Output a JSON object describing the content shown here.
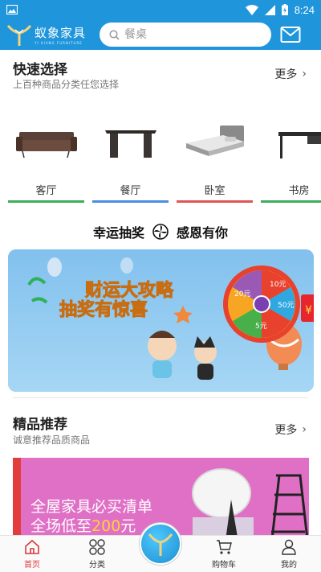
{
  "status_bar": {
    "time": "8:24"
  },
  "header": {
    "logo_name": "蚁象家具",
    "logo_sub": "YI XIANG FURNITURE",
    "search_placeholder": "餐桌"
  },
  "quick_select": {
    "title": "快速选择",
    "subtitle": "上百种商品分类任您选择",
    "more": "更多",
    "categories": [
      {
        "label": "客厅",
        "color": "#3fae5a"
      },
      {
        "label": "餐厅",
        "color": "#4a8de0"
      },
      {
        "label": "卧室",
        "color": "#e25555"
      },
      {
        "label": "书房",
        "color": "#3fae5a"
      }
    ]
  },
  "lottery": {
    "title_left": "幸运抽奖",
    "title_right": "感恩有你",
    "banner_line1": "财运大攻略",
    "banner_line2": "抽奖有惊喜",
    "wheel_labels": [
      "10元",
      "50元",
      "5元",
      "20元"
    ]
  },
  "featured": {
    "title": "精品推荐",
    "subtitle": "诚意推荐品质商品",
    "more": "更多",
    "promo_line1": "全屋家具必买清单",
    "promo_line2_prefix": "全场低至",
    "promo_line2_amount": "200",
    "promo_line2_suffix": "元"
  },
  "bottom_nav": {
    "items": [
      {
        "label": "首页",
        "icon": "home-icon",
        "active": true
      },
      {
        "label": "分类",
        "icon": "grid-icon",
        "active": false
      },
      {
        "label": "购物车",
        "icon": "cart-icon",
        "active": false
      },
      {
        "label": "我的",
        "icon": "user-icon",
        "active": false
      }
    ],
    "accent": "#d9393a"
  },
  "colors": {
    "primary": "#1f96dc"
  }
}
